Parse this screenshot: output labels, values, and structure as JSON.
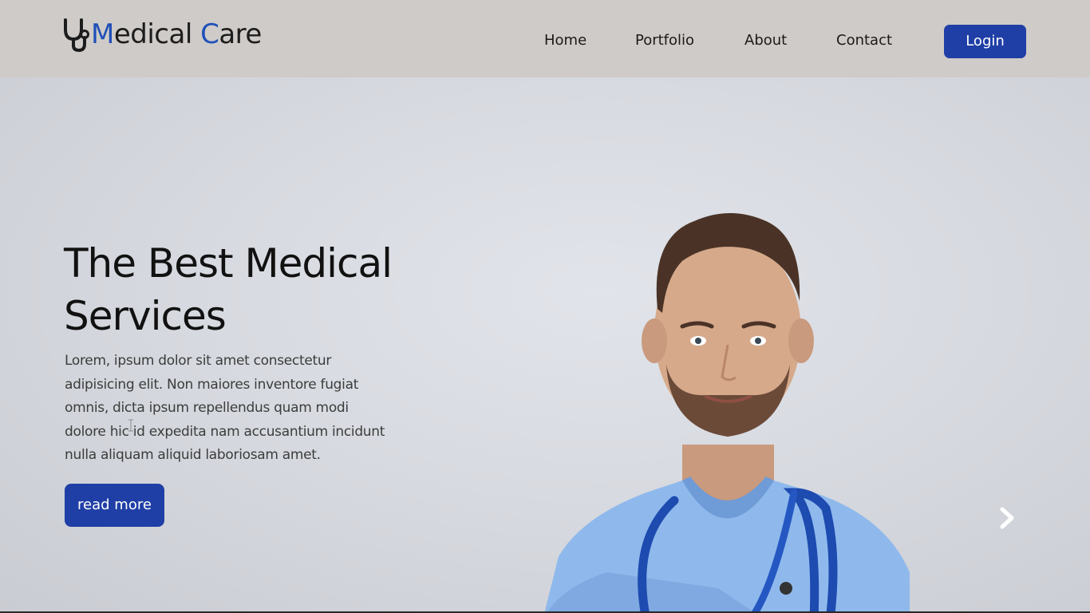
{
  "brand": {
    "logo_part1": "M",
    "logo_part2": "edical ",
    "logo_part3": "C",
    "logo_part4": "are",
    "icon": "stethoscope-icon",
    "accent_color": "#1f4fb8"
  },
  "nav": {
    "items": [
      {
        "label": "Home"
      },
      {
        "label": "Portfolio"
      },
      {
        "label": "About"
      },
      {
        "label": "Contact"
      }
    ],
    "login_label": "Login"
  },
  "hero": {
    "title": "The Best Medical Services",
    "description": "Lorem, ipsum dolor sit amet consectetur adipisicing elit. Non maiores inventore fugiat omnis, dicta ipsum repellendus quam modi dolore hic id expedita nam accusantium incidunt nulla aliquam aliquid laboriosam amet.",
    "button_label": "read more",
    "next_icon": "chevron-right-icon"
  },
  "colors": {
    "button": "#1f3fa6",
    "navbar_bg": "#cfcbc8",
    "scrubs": "#8fb9ec"
  }
}
